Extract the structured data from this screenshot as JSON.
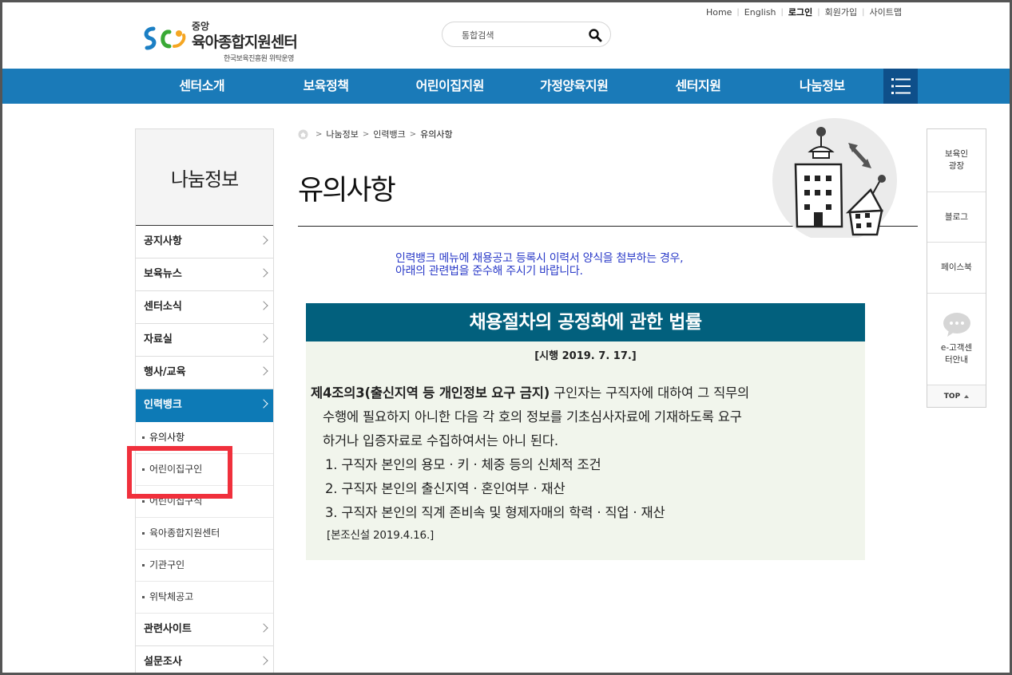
{
  "header": {
    "logo_small": "중앙",
    "logo_main": "육아종합지원센터",
    "logo_sub": "한국보육진흥원 위탁운영",
    "search_placeholder": "통합검색",
    "utility_links": [
      "Home",
      "English",
      "로그인",
      "회원가입",
      "사이트맵"
    ]
  },
  "gnb": {
    "items": [
      "센터소개",
      "보육정책",
      "어린이집지원",
      "가정양육지원",
      "센터지원",
      "나눔정보"
    ]
  },
  "lnb": {
    "title": "나눔정보",
    "items_top": [
      "공지사항",
      "보육뉴스",
      "센터소식",
      "자료실",
      "행사/교육"
    ],
    "active": "인력뱅크",
    "subs": [
      "유의사항",
      "어린이집구인",
      "어린이집구직",
      "육아종합지원센터",
      "기관구인",
      "위탁체공고"
    ],
    "items_bottom": [
      "관련사이트",
      "설문조사"
    ]
  },
  "breadcrumb": [
    "나눔정보",
    "인력뱅크",
    "유의사항"
  ],
  "page_title": "유의사항",
  "intro": {
    "line1": "인력뱅크 메뉴에 채용공고 등록시 이력서 양식을 첨부하는 경우,",
    "line2": "아래의 관련법을 준수해 주시기 바랍니다."
  },
  "law": {
    "title": "채용절차의 공정화에 관한 법률",
    "date": "[시행 2019. 7. 17.]",
    "article_head": "제4조의3(출신지역 등 개인정보 요구 금지)",
    "article_text1": " 구인자는 구직자에 대하여 그 직무의",
    "article_text2": "수행에 필요하지 아니한 다음 각 호의 정보를 기초심사자료에 기재하도록 요구",
    "article_text3": "하거나 입증자료로 수집하여서는 아니 된다.",
    "items": [
      "1. 구직자 본인의 용모 · 키 · 체중 등의 신체적 조건",
      "2. 구직자 본인의 출신지역 · 혼인여부 · 재산",
      "3. 구직자 본인의 직계 존비속 및 형제자매의 학력 · 직업 · 재산"
    ],
    "note": "[본조신설 2019.4.16.]"
  },
  "quick": {
    "q1_line1": "보육인",
    "q1_line2": "광장",
    "q2": "블로그",
    "q3": "페이스북",
    "q4_line1": "e-고객센",
    "q4_line2": "터안내",
    "top": "TOP"
  },
  "colors": {
    "gnb_bg": "#1a7ab8",
    "gnb_allmenu": "#0e4f8a",
    "lnb_active": "#0d7ab6",
    "law_head": "#02607d",
    "law_bg": "#f1f5ec",
    "intro_text": "#2a3ac8",
    "highlight": "#f0303c"
  }
}
